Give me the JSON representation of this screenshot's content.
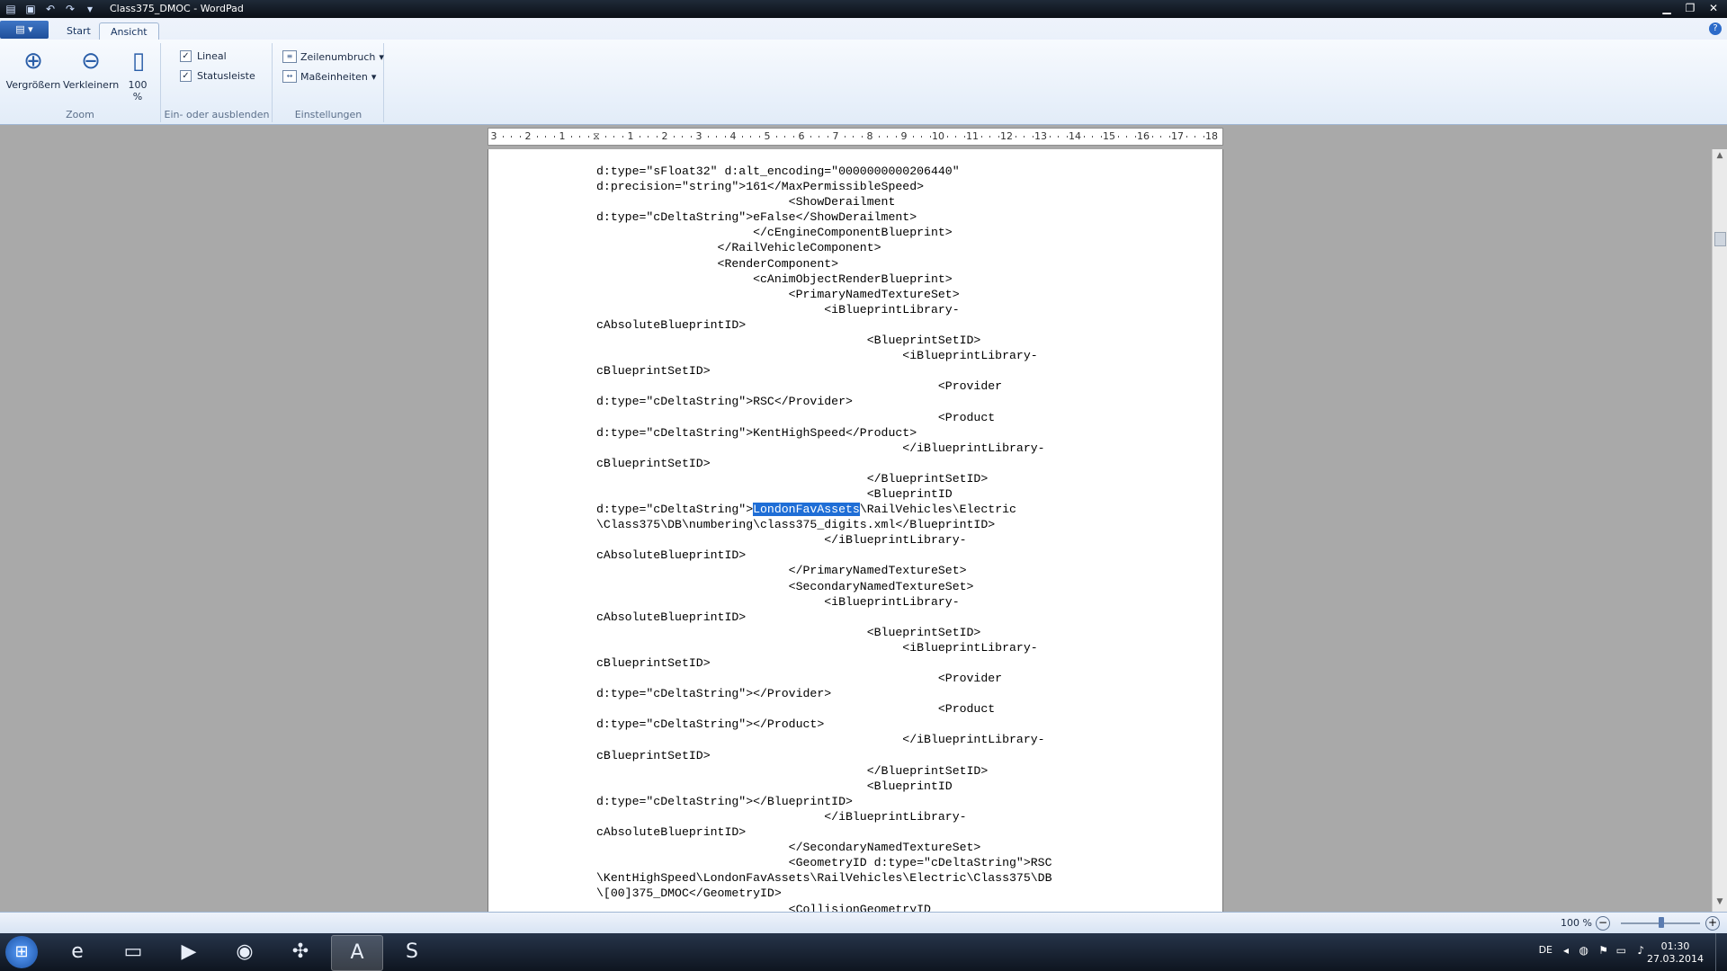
{
  "titlebar": {
    "title": "Class375_DMOC - WordPad",
    "quick_access": [
      "save-icon",
      "undo-icon",
      "redo-icon",
      "chevron-down-icon"
    ],
    "window_buttons": [
      "minimize-icon",
      "maximize-icon",
      "close-icon"
    ]
  },
  "ribbon": {
    "app_menu_icon": "menu-icon",
    "tabs": [
      {
        "label": "Start",
        "active": false
      },
      {
        "label": "Ansicht",
        "active": true
      }
    ],
    "zoom_group": {
      "label": "Zoom",
      "zoom_in": "Vergrößern",
      "zoom_out": "Verkleinern",
      "zoom_100": "100 %"
    },
    "show_group": {
      "label": "Ein- oder ausblenden",
      "ruler": {
        "label": "Lineal",
        "checked": true
      },
      "statusbar": {
        "label": "Statusleiste",
        "checked": true
      }
    },
    "settings_group": {
      "label": "Einstellungen",
      "word_wrap": "Zeilenumbruch",
      "units": "Maßeinheiten"
    }
  },
  "ruler": {
    "labels": [
      "3",
      "2",
      "1",
      "",
      "1",
      "2",
      "3",
      "4",
      "5",
      "6",
      "7",
      "8",
      "9",
      "10",
      "11",
      "12",
      "13",
      "14",
      "15",
      "16",
      "17",
      "18"
    ]
  },
  "document": {
    "before_selection": "d:type=\"sFloat32\" d:alt_encoding=\"0000000000206440\"\nd:precision=\"string\">161</MaxPermissibleSpeed>\n                           <ShowDerailment\nd:type=\"cDeltaString\">eFalse</ShowDerailment>\n                      </cEngineComponentBlueprint>\n                 </RailVehicleComponent>\n                 <RenderComponent>\n                      <cAnimObjectRenderBlueprint>\n                           <PrimaryNamedTextureSet>\n                                <iBlueprintLibrary-\ncAbsoluteBlueprintID>\n                                      <BlueprintSetID>\n                                           <iBlueprintLibrary-\ncBlueprintSetID>\n                                                <Provider\nd:type=\"cDeltaString\">RSC</Provider>\n                                                <Product\nd:type=\"cDeltaString\">KentHighSpeed</Product>\n                                           </iBlueprintLibrary-\ncBlueprintSetID>\n                                      </BlueprintSetID>\n                                      <BlueprintID\nd:type=\"cDeltaString\">",
    "selection": "LondonFavAssets",
    "after_selection": "\\RailVehicles\\Electric\n\\Class375\\DB\\numbering\\class375_digits.xml</BlueprintID>\n                                </iBlueprintLibrary-\ncAbsoluteBlueprintID>\n                           </PrimaryNamedTextureSet>\n                           <SecondaryNamedTextureSet>\n                                <iBlueprintLibrary-\ncAbsoluteBlueprintID>\n                                      <BlueprintSetID>\n                                           <iBlueprintLibrary-\ncBlueprintSetID>\n                                                <Provider\nd:type=\"cDeltaString\"></Provider>\n                                                <Product\nd:type=\"cDeltaString\"></Product>\n                                           </iBlueprintLibrary-\ncBlueprintSetID>\n                                      </BlueprintSetID>\n                                      <BlueprintID\nd:type=\"cDeltaString\"></BlueprintID>\n                                </iBlueprintLibrary-\ncAbsoluteBlueprintID>\n                           </SecondaryNamedTextureSet>\n                           <GeometryID d:type=\"cDeltaString\">RSC\n\\KentHighSpeed\\LondonFavAssets\\RailVehicles\\Electric\\Class375\\DB\n\\[00]375_DMOC</GeometryID>\n                           <CollisionGeometryID"
  },
  "statusbar": {
    "zoom_label": "100 %",
    "zoom_level_percent": 100
  },
  "taskbar": {
    "start_icon": "windows-start-icon",
    "apps": [
      {
        "icon": "internet-explorer-icon",
        "glyph": "e",
        "active": false
      },
      {
        "icon": "file-explorer-icon",
        "glyph": "▭",
        "active": false
      },
      {
        "icon": "media-player-icon",
        "glyph": "▶",
        "active": false
      },
      {
        "icon": "firefox-icon",
        "glyph": "◉",
        "active": false
      },
      {
        "icon": "game-controller-icon",
        "glyph": "✣",
        "active": false
      },
      {
        "icon": "wordpad-icon",
        "glyph": "A",
        "active": true
      },
      {
        "icon": "teamviewer-icon",
        "glyph": "S",
        "active": false
      }
    ],
    "language": "DE",
    "tray_icons": [
      "chevron-up-icon",
      "network-globe-icon",
      "flag-icon",
      "battery-icon",
      "volume-icon"
    ],
    "time": "01:30",
    "date": "27.03.2014"
  }
}
